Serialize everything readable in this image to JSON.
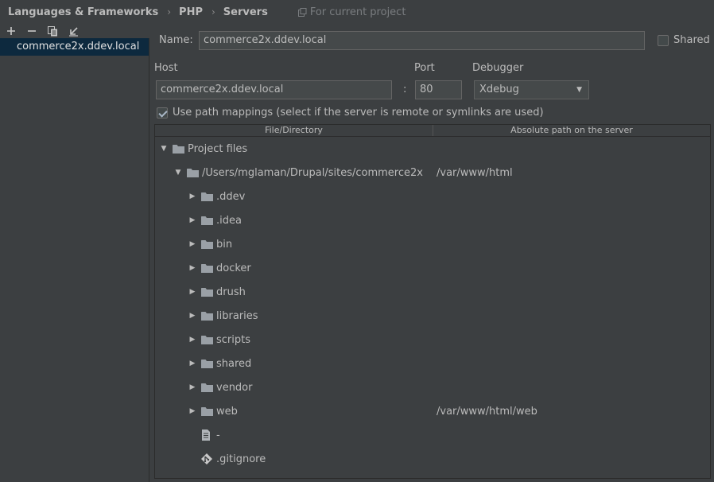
{
  "breadcrumb": {
    "items": [
      "Languages & Frameworks",
      "PHP",
      "Servers"
    ],
    "scope": "For current project"
  },
  "toolbar": {
    "add_icon": "plus-icon",
    "remove_icon": "minus-icon",
    "copy_icon": "copy-icon",
    "import_icon": "import-icon"
  },
  "sidebar": {
    "items": [
      {
        "label": "commerce2x.ddev.local",
        "selected": true
      }
    ]
  },
  "form": {
    "name_label": "Name:",
    "name_value": "commerce2x.ddev.local",
    "shared_label": "Shared",
    "shared_checked": false,
    "host_label": "Host",
    "host_value": "commerce2x.ddev.local",
    "colon": ":",
    "port_label": "Port",
    "port_value": "80",
    "debugger_label": "Debugger",
    "debugger_value": "Xdebug",
    "path_mappings_label": "Use path mappings (select if the server is remote or symlinks are used)",
    "path_mappings_checked": true
  },
  "table": {
    "columns": [
      "File/Directory",
      "Absolute path on the server"
    ],
    "rows": [
      {
        "name": "Project files",
        "path": "",
        "icon": "folder-icon",
        "indent": 0,
        "expand": "open"
      },
      {
        "name": "/Users/mglaman/Drupal/sites/commerce2x",
        "path": "/var/www/html",
        "icon": "folder-icon",
        "indent": 1,
        "expand": "open"
      },
      {
        "name": ".ddev",
        "path": "",
        "icon": "folder-icon",
        "indent": 2,
        "expand": "closed"
      },
      {
        "name": ".idea",
        "path": "",
        "icon": "folder-icon",
        "indent": 2,
        "expand": "closed"
      },
      {
        "name": "bin",
        "path": "",
        "icon": "folder-icon",
        "indent": 2,
        "expand": "closed"
      },
      {
        "name": "docker",
        "path": "",
        "icon": "folder-icon",
        "indent": 2,
        "expand": "closed"
      },
      {
        "name": "drush",
        "path": "",
        "icon": "folder-icon",
        "indent": 2,
        "expand": "closed"
      },
      {
        "name": "libraries",
        "path": "",
        "icon": "folder-icon",
        "indent": 2,
        "expand": "closed"
      },
      {
        "name": "scripts",
        "path": "",
        "icon": "folder-icon",
        "indent": 2,
        "expand": "closed"
      },
      {
        "name": "shared",
        "path": "",
        "icon": "folder-icon",
        "indent": 2,
        "expand": "closed"
      },
      {
        "name": "vendor",
        "path": "",
        "icon": "folder-icon",
        "indent": 2,
        "expand": "closed"
      },
      {
        "name": "web",
        "path": "/var/www/html/web",
        "icon": "folder-icon",
        "indent": 2,
        "expand": "closed"
      },
      {
        "name": "-",
        "path": "",
        "icon": "file-icon",
        "indent": 2,
        "expand": "none"
      },
      {
        "name": ".gitignore",
        "path": "",
        "icon": "git-file-icon",
        "indent": 2,
        "expand": "none"
      }
    ]
  },
  "colors": {
    "background": "#3c3f41",
    "selection": "#0d293e",
    "text": "#bbbbbb",
    "input_bg": "#45494a"
  }
}
